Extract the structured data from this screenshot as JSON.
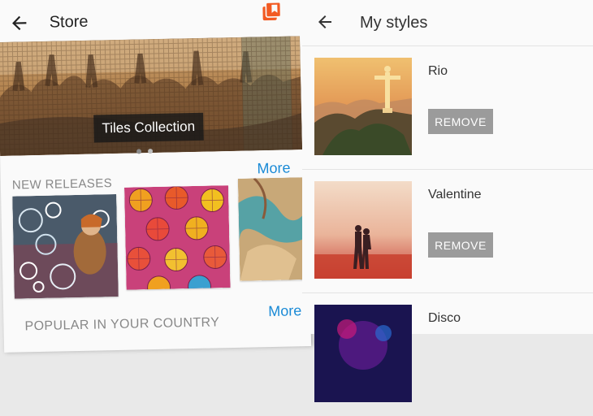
{
  "store": {
    "title": "Store",
    "banner_caption": "Tiles Collection",
    "new_releases_title": "NEW RELEASES",
    "popular_title": "POPULAR IN YOUR COUNTRY",
    "more_label": "More",
    "colors": {
      "accent_link": "#1a8ad6",
      "badge": "#f25a22"
    }
  },
  "my_styles": {
    "title": "My styles",
    "items": [
      {
        "name": "Rio",
        "button": "REMOVE"
      },
      {
        "name": "Valentine",
        "button": "REMOVE"
      },
      {
        "name": "Disco"
      }
    ]
  }
}
